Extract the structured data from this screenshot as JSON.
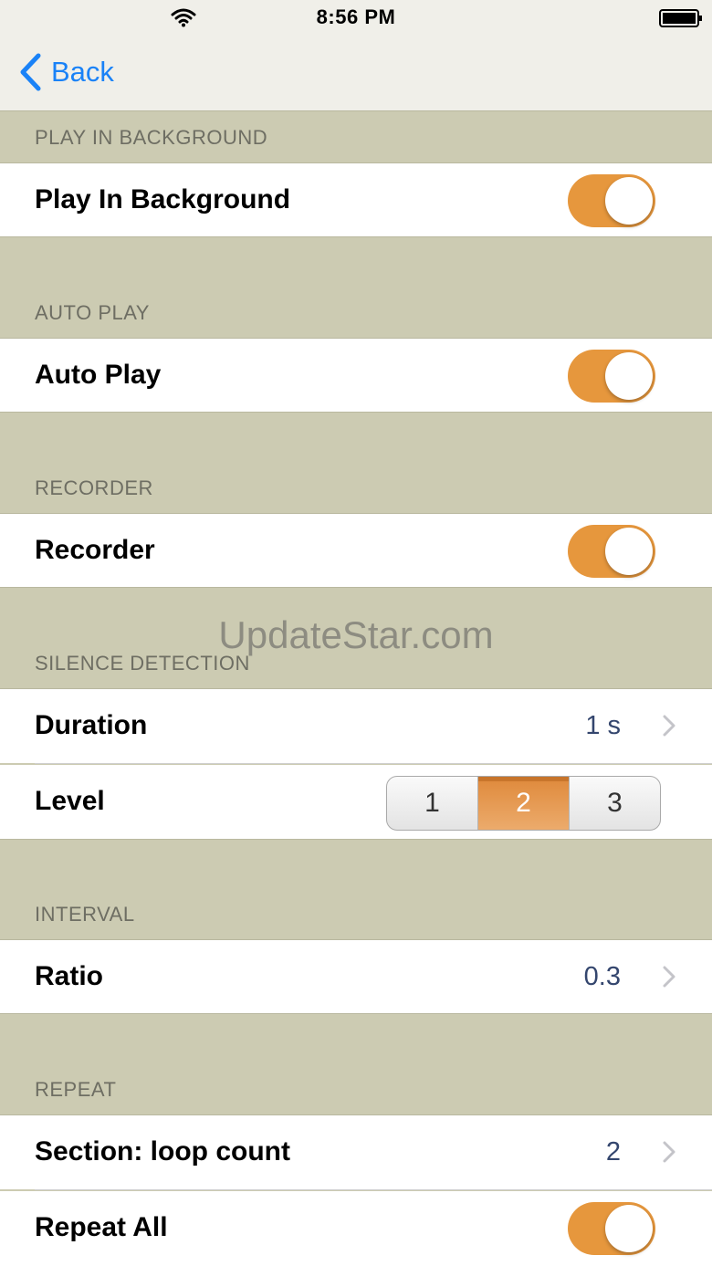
{
  "status_bar": {
    "time": "8:56 PM"
  },
  "nav": {
    "back_label": "Back"
  },
  "sections": {
    "play_in_background": {
      "header": "PLAY IN BACKGROUND",
      "row_label": "Play In Background",
      "toggle_on": true
    },
    "auto_play": {
      "header": "AUTO PLAY",
      "row_label": "Auto Play",
      "toggle_on": true
    },
    "recorder": {
      "header": "RECORDER",
      "row_label": "Recorder",
      "toggle_on": true
    },
    "silence_detection": {
      "header": "SILENCE DETECTION",
      "duration_label": "Duration",
      "duration_value": "1 s",
      "level_label": "Level",
      "level_options": [
        "1",
        "2",
        "3"
      ],
      "level_selected": "2"
    },
    "interval": {
      "header": "INTERVAL",
      "ratio_label": "Ratio",
      "ratio_value": "0.3"
    },
    "repeat": {
      "header": "REPEAT",
      "loop_label": "Section: loop count",
      "loop_value": "2",
      "repeat_all_label": "Repeat All",
      "repeat_all_on": true
    }
  },
  "watermark": "UpdateStar.com",
  "colors": {
    "accent": "#e6973d",
    "back_blue": "#1a82f7",
    "section_bg": "#cccbb2"
  }
}
